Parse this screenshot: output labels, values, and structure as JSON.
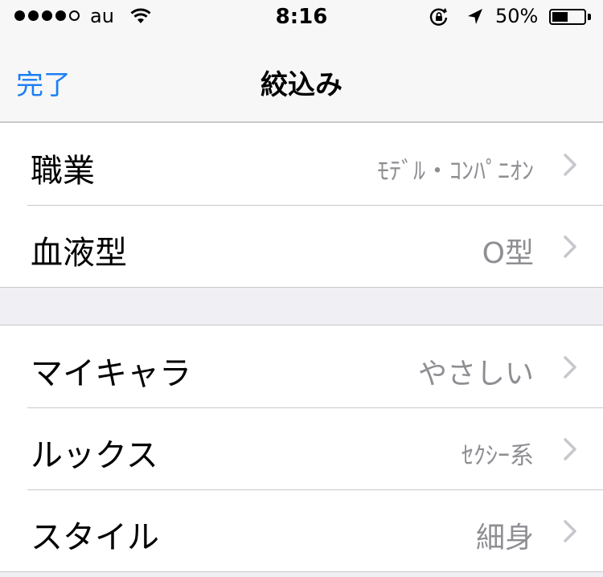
{
  "status_bar": {
    "carrier": "au",
    "time": "8:16",
    "battery_percent": "50%",
    "battery_level": 0.5,
    "signal_bars": 4,
    "signal_max": 5
  },
  "nav": {
    "done_label": "完了",
    "title": "絞込み"
  },
  "groups": [
    {
      "rows": [
        {
          "label": "職業",
          "value": "ﾓﾃﾞﾙ・ｺﾝﾊﾟﾆｵﾝ"
        },
        {
          "label": "血液型",
          "value": "O型"
        }
      ]
    },
    {
      "rows": [
        {
          "label": "マイキャラ",
          "value": "やさしい"
        },
        {
          "label": "ルックス",
          "value": "ｾｸｼｰ系"
        },
        {
          "label": "スタイル",
          "value": "細身"
        }
      ]
    }
  ],
  "colors": {
    "accent": "#1a7ff5",
    "value_gray": "#8e8e93",
    "separator": "#c8c7cc",
    "background": "#efeff4"
  }
}
